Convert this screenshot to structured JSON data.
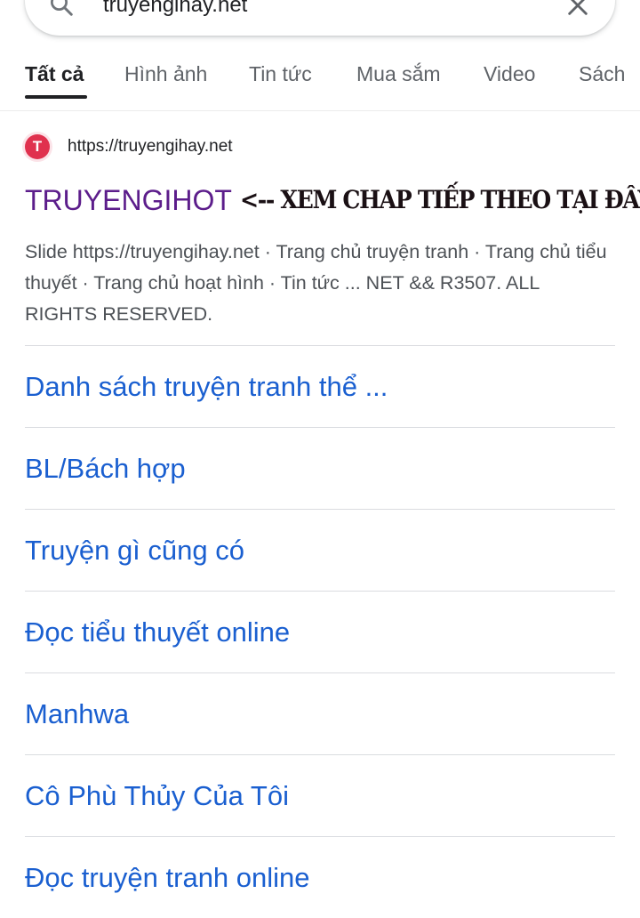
{
  "search": {
    "query": "truyengihay.net"
  },
  "tabs": [
    {
      "label": "Tất cả",
      "active": true
    },
    {
      "label": "Hình ảnh",
      "active": false
    },
    {
      "label": "Tin tức",
      "active": false
    },
    {
      "label": "Mua sắm",
      "active": false
    },
    {
      "label": "Video",
      "active": false
    },
    {
      "label": "Sách",
      "active": false
    }
  ],
  "result": {
    "favicon_letter": "T",
    "url": "https://truyengihay.net",
    "title": "TRUYENGIHOT",
    "overlay_note": "<-- XEM CHAP TIẾP THEO TẠI ĐÂY",
    "snippet": "Slide https://truyengihay.net · Trang chủ truyện tranh · Trang chủ tiểu thuyết · Trang chủ hoạt hình · Tin tức ... NET && R3507. ALL RIGHTS RESERVED."
  },
  "sitelinks": [
    "Danh sách truyện tranh thể ...",
    "BL/Bách hợp",
    "Truyện gì cũng có",
    "Đọc tiểu thuyết online",
    "Manhwa",
    "Cô Phù Thủy Của Tôi",
    "Đọc truyện tranh online"
  ],
  "colors": {
    "visited_title": "#5c1d8b",
    "link_blue": "#1a5fd0",
    "favicon_red": "#e0314e"
  }
}
